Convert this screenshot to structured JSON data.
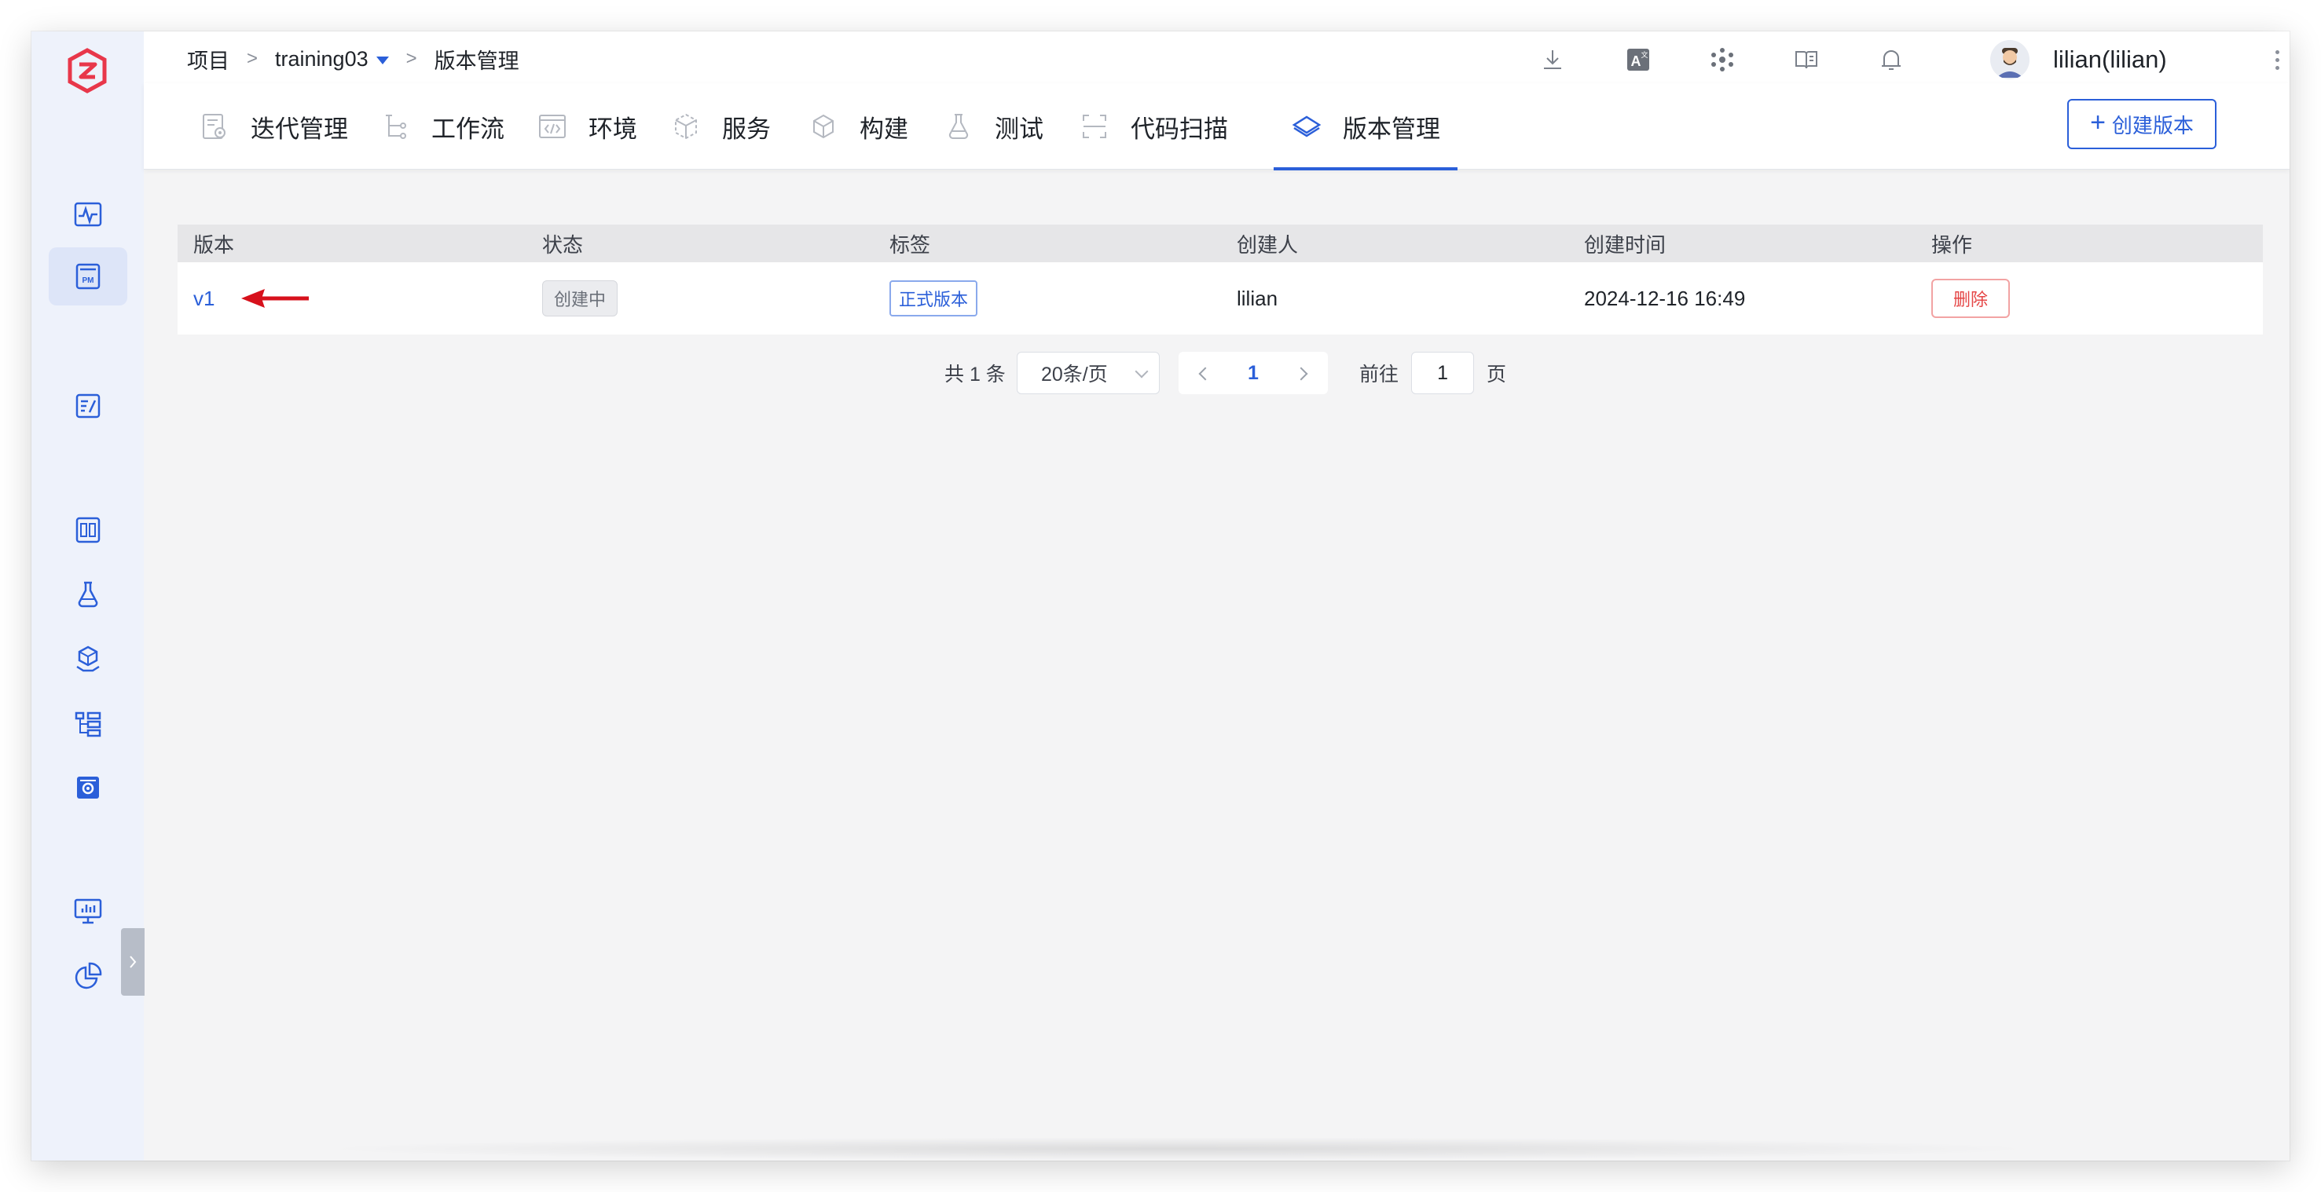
{
  "breadcrumb": {
    "root": "项目",
    "sep": ">",
    "project": "training03",
    "current": "版本管理"
  },
  "user": {
    "name": "lilian(lilian)"
  },
  "tabs": [
    {
      "label": "迭代管理",
      "icon": "iteration-icon"
    },
    {
      "label": "工作流",
      "icon": "workflow-icon"
    },
    {
      "label": "环境",
      "icon": "environment-icon"
    },
    {
      "label": "服务",
      "icon": "service-icon"
    },
    {
      "label": "构建",
      "icon": "build-icon"
    },
    {
      "label": "测试",
      "icon": "test-flask-icon"
    },
    {
      "label": "代码扫描",
      "icon": "code-scan-icon"
    },
    {
      "label": "版本管理",
      "icon": "version-icon",
      "active": true
    }
  ],
  "toolbar": {
    "create_label": "创建版本",
    "create_icon": "+"
  },
  "table": {
    "headers": [
      "版本",
      "状态",
      "标签",
      "创建人",
      "创建时间",
      "操作"
    ],
    "rows": [
      {
        "version": "v1",
        "status": "创建中",
        "tag": "正式版本",
        "creator": "lilian",
        "created_at": "2024-12-16 16:49",
        "action": "删除"
      }
    ]
  },
  "pagination": {
    "total": "共 1 条",
    "page_size": "20条/页",
    "current_page": "1",
    "goto_label": "前往",
    "goto_value": "1",
    "page_suffix": "页"
  },
  "colors": {
    "accent": "#2b5fd9",
    "danger": "#e54545",
    "brand": "#e8374a",
    "sidebar_bg": "#eef2fb"
  }
}
